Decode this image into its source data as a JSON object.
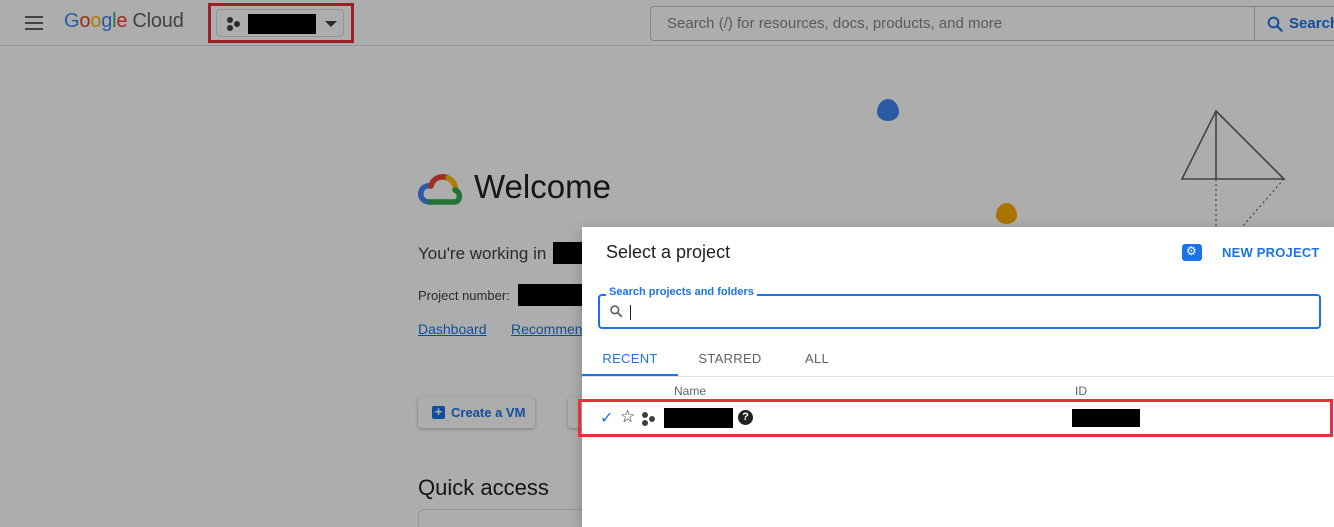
{
  "header": {
    "logo": {
      "google": [
        "G",
        "o",
        "o",
        "g",
        "l",
        "e"
      ],
      "product": "Cloud"
    },
    "search_placeholder": "Search (/) for resources, docs, products, and more",
    "search_button_label": "Search"
  },
  "welcome": {
    "title": "Welcome",
    "working_in": "You're working in",
    "project_number_label": "Project number:",
    "links": [
      "Dashboard",
      "Recommen"
    ],
    "create_vm_label": "Create a VM",
    "quick_access_title": "Quick access"
  },
  "dialog": {
    "title": "Select a project",
    "new_project_label": "NEW PROJECT",
    "search_label": "Search projects and folders",
    "search_value": "",
    "tabs": [
      "RECENT",
      "STARRED",
      "ALL"
    ],
    "active_tab": "RECENT",
    "columns": {
      "name": "Name",
      "id": "ID"
    },
    "rows": [
      {
        "selected": true,
        "starred": false
      }
    ]
  },
  "colors": {
    "accent": "#1a73e8",
    "highlight_box": "#e53238",
    "scrim": "rgba(0,0,0,0.32)"
  },
  "icons": [
    "menu-icon",
    "project-icon",
    "dropdown-caret-icon",
    "search-icon",
    "new-project-icon",
    "checkmark-icon",
    "star-icon",
    "help-icon"
  ]
}
